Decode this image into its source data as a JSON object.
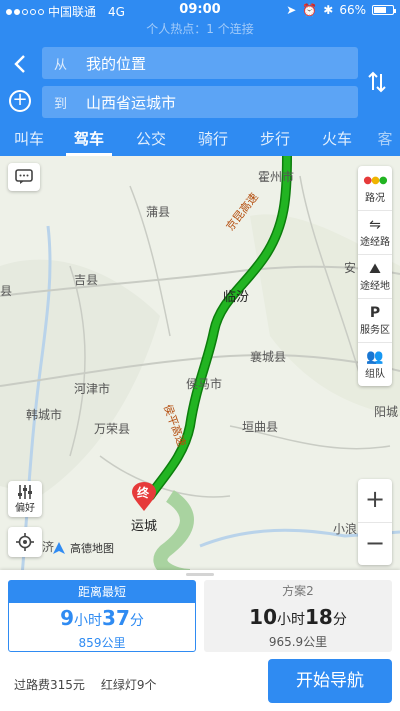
{
  "status_bar": {
    "carrier": "中国联通",
    "network": "4G",
    "time": "09:00",
    "battery": "66%",
    "battery_level": 0.66
  },
  "hotspot": "个人热点：1 个连接",
  "route_form": {
    "from_prefix": "从",
    "from_value": "我的位置",
    "to_prefix": "到",
    "to_value": "山西省运城市"
  },
  "tabs": [
    "叫车",
    "驾车",
    "公交",
    "骑行",
    "步行",
    "火车",
    "客"
  ],
  "active_tab": "驾车",
  "map": {
    "labels": [
      "霍州市",
      "蒲县",
      "吉县",
      "县",
      "临汾",
      "安",
      "襄城县",
      "侯马市",
      "河津市",
      "万荣县",
      "韩城市",
      "垣曲县",
      "阳城",
      "运城",
      "小浪",
      "济"
    ],
    "road_labels": [
      "京昆高速",
      "侯平高速"
    ],
    "end_marker": "终",
    "logo_text": "高德地图",
    "tools": [
      "路况",
      "途经路",
      "途经地",
      "服务区",
      "组队"
    ],
    "preference_label": "偏好",
    "route_color": "#1aa01a",
    "zoom_in": "+",
    "zoom_out": "−"
  },
  "plans": [
    {
      "tag": "距离最短",
      "hours": "9",
      "hour_unit": "小时",
      "minutes": "37",
      "minute_unit": "分",
      "distance": "859公里"
    },
    {
      "tag": "方案2",
      "hours": "10",
      "hour_unit": "小时",
      "minutes": "18",
      "minute_unit": "分",
      "distance": "965.9公里"
    }
  ],
  "toll": "过路费315元",
  "traffic_lights": "红绿灯9个",
  "start_button": "开始导航",
  "colors": {
    "primary": "#2f8bf2",
    "route": "#1aa01a"
  }
}
